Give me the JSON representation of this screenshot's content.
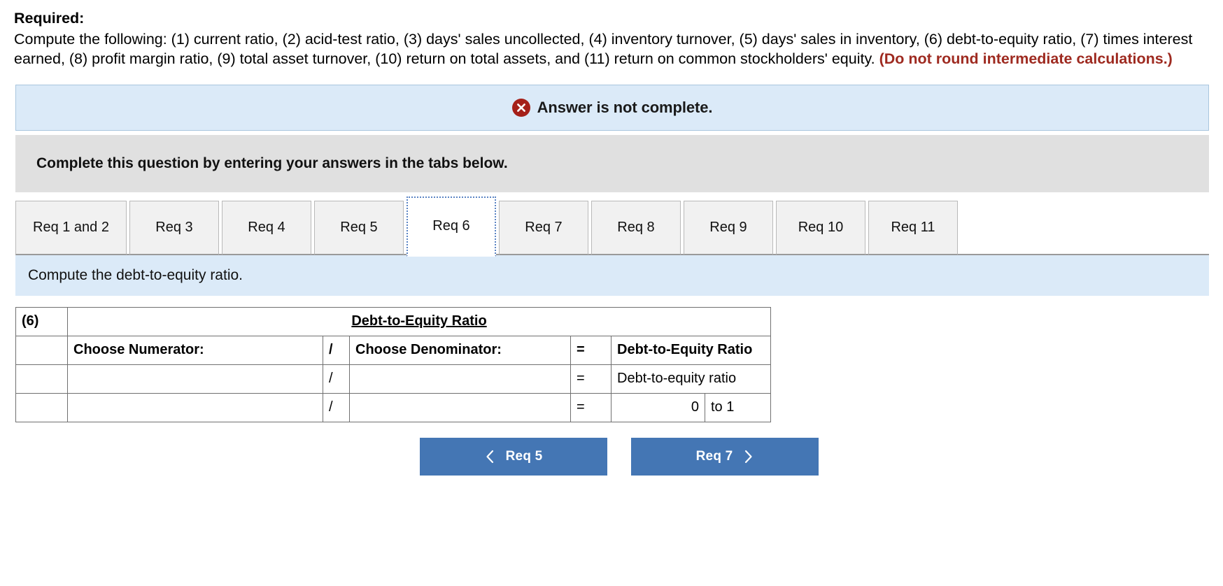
{
  "prompt": {
    "label": "Required:",
    "body": "Compute the following: (1) current ratio, (2) acid-test ratio, (3) days' sales uncollected, (4) inventory turnover, (5) days' sales in inventory, (6) debt-to-equity ratio, (7) times interest earned, (8) profit margin ratio, (9) total asset turnover, (10) return on total assets, and (11) return on common stockholders' equity. ",
    "emphasis": "(Do not round intermediate calculations.)"
  },
  "notice": {
    "icon": "error-x-circle-icon",
    "text": "Answer is not complete.",
    "bg_color": "#dbeaf8",
    "icon_color": "#a52019"
  },
  "instruction": {
    "text": "Complete this question by entering your answers in the tabs below.",
    "bg_color": "#e0e0e0"
  },
  "tabs": {
    "items": [
      {
        "label": "Req 1 and 2",
        "active": false
      },
      {
        "label": "Req 3",
        "active": false
      },
      {
        "label": "Req 4",
        "active": false
      },
      {
        "label": "Req 5",
        "active": false
      },
      {
        "label": "Req 6",
        "active": true
      },
      {
        "label": "Req 7",
        "active": false
      },
      {
        "label": "Req 8",
        "active": false
      },
      {
        "label": "Req 9",
        "active": false
      },
      {
        "label": "Req 10",
        "active": false
      },
      {
        "label": "Req 11",
        "active": false
      }
    ]
  },
  "sub_instruction": {
    "text": "Compute the debt-to-equity ratio.",
    "bg_color": "#dbeaf8"
  },
  "answer_table": {
    "index_label": "(6)",
    "title": "Debt-to-Equity Ratio",
    "header_bg": "#85aee0",
    "columns": {
      "numerator": "Choose Numerator:",
      "slash": "/",
      "denominator": "Choose Denominator:",
      "equals": "=",
      "result": "Debt-to-Equity Ratio"
    },
    "rows": [
      {
        "index": "",
        "numerator": "",
        "slash": "/",
        "denominator": "",
        "equals": "=",
        "result": "Debt-to-equity ratio",
        "unit": ""
      },
      {
        "index": "",
        "numerator": "",
        "slash": "/",
        "denominator": "",
        "equals": "=",
        "result": "0",
        "unit": "to 1"
      }
    ]
  },
  "nav": {
    "prev": {
      "label": "Req 5",
      "icon": "chevron-left-icon"
    },
    "next": {
      "label": "Req 7",
      "icon": "chevron-right-icon"
    },
    "color": "#4476b4"
  }
}
